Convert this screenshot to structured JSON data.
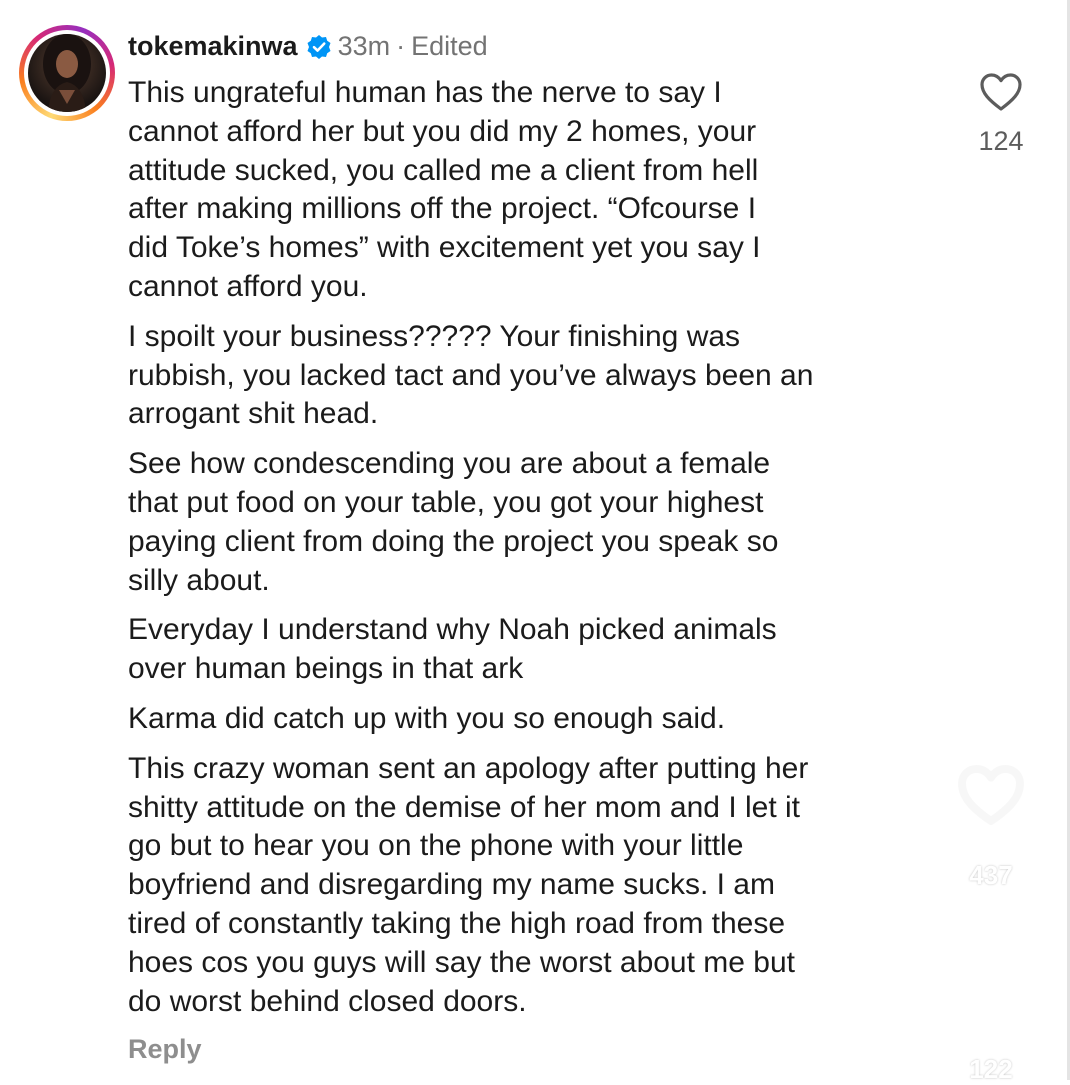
{
  "comment": {
    "username": "tokemakinwa",
    "verified": true,
    "time": "33m",
    "separator": "·",
    "edited_label": "Edited",
    "paragraphs": [
      "This ungrateful human has the nerve to say I\ncannot afford her but you did my 2 homes, your\nattitude sucked, you called me a client from hell\nafter making millions off the project. “Ofcourse I\ndid Toke’s homes” with excitement yet you say I\ncannot afford you.",
      "I spoilt your business????? Your finishing was\nrubbish, you lacked tact and you’ve always been an\narrogant shit head.",
      "See how condescending you are about a female\nthat put food on your table, you got your highest\npaying client from doing the project you speak so\nsilly about.",
      "Everyday I understand why Noah picked animals\nover human beings in that ark",
      "Karma did catch up with you so enough said.",
      "This crazy woman sent an apology after putting her\nshitty attitude on the demise of her mom and I let it\ngo but to hear you on the phone with your little\nboyfriend and disregarding my name sucks. I am\ntired of constantly taking the high road from these\nhoes cos you guys will say the worst about me but\ndo worst behind closed doors."
    ],
    "reply_label": "Reply",
    "like_count": "124",
    "like_icon": "heart-outline-icon"
  },
  "overlay": {
    "like_count": "437",
    "comment_count": "122",
    "like_icon": "heart-outline-icon",
    "comment_icon": "speech-bubble-icon"
  },
  "colors": {
    "text": "#1b1b1b",
    "meta": "#737373",
    "reply": "#8e8e8e",
    "verified_blue": "#0095f6",
    "overlay_white": "#ffffff"
  }
}
